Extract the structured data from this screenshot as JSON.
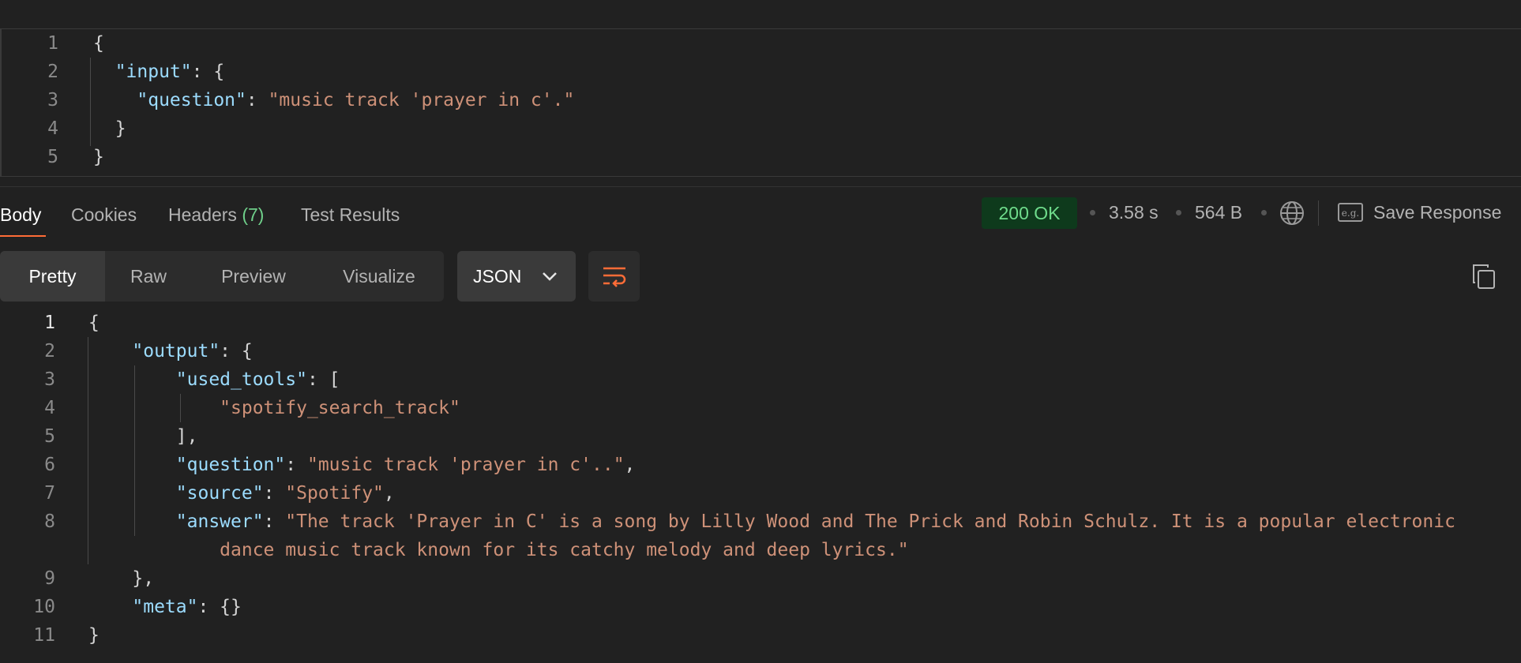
{
  "request": {
    "lines": [
      {
        "n": "1",
        "parts": [
          {
            "t": "{",
            "c": "p"
          }
        ]
      },
      {
        "n": "2",
        "parts": [
          {
            "t": "  ",
            "c": "p"
          },
          {
            "t": "\"input\"",
            "c": "k"
          },
          {
            "t": ": {",
            "c": "p"
          }
        ]
      },
      {
        "n": "3",
        "parts": [
          {
            "t": "    ",
            "c": "p"
          },
          {
            "t": "\"question\"",
            "c": "k"
          },
          {
            "t": ": ",
            "c": "p"
          },
          {
            "t": "\"music track 'prayer in c'.\"",
            "c": "s"
          }
        ]
      },
      {
        "n": "4",
        "parts": [
          {
            "t": "  }",
            "c": "p"
          }
        ]
      },
      {
        "n": "5",
        "parts": [
          {
            "t": "}",
            "c": "p"
          }
        ]
      }
    ]
  },
  "response_tabs": [
    {
      "label": "Body",
      "active": true
    },
    {
      "label": "Cookies"
    },
    {
      "label": "Headers",
      "count": "(7)"
    },
    {
      "label": "Test Results"
    }
  ],
  "status": {
    "code": "200 OK",
    "time": "3.58 s",
    "size": "564 B",
    "save_label": "Save Response"
  },
  "view_modes": [
    "Pretty",
    "Raw",
    "Preview",
    "Visualize"
  ],
  "format": "JSON",
  "response": {
    "lines": [
      {
        "n": "1",
        "parts": [
          {
            "t": "{",
            "c": "p"
          }
        ]
      },
      {
        "n": "2",
        "parts": [
          {
            "t": "    ",
            "c": "p"
          },
          {
            "t": "\"output\"",
            "c": "k"
          },
          {
            "t": ": {",
            "c": "p"
          }
        ]
      },
      {
        "n": "3",
        "parts": [
          {
            "t": "        ",
            "c": "p"
          },
          {
            "t": "\"used_tools\"",
            "c": "k"
          },
          {
            "t": ": [",
            "c": "p"
          }
        ]
      },
      {
        "n": "4",
        "parts": [
          {
            "t": "            ",
            "c": "p"
          },
          {
            "t": "\"spotify_search_track\"",
            "c": "s"
          }
        ]
      },
      {
        "n": "5",
        "parts": [
          {
            "t": "        ],",
            "c": "p"
          }
        ]
      },
      {
        "n": "6",
        "parts": [
          {
            "t": "        ",
            "c": "p"
          },
          {
            "t": "\"question\"",
            "c": "k"
          },
          {
            "t": ": ",
            "c": "p"
          },
          {
            "t": "\"music track 'prayer in c'..\"",
            "c": "s"
          },
          {
            "t": ",",
            "c": "p"
          }
        ]
      },
      {
        "n": "7",
        "parts": [
          {
            "t": "        ",
            "c": "p"
          },
          {
            "t": "\"source\"",
            "c": "k"
          },
          {
            "t": ": ",
            "c": "p"
          },
          {
            "t": "\"Spotify\"",
            "c": "s"
          },
          {
            "t": ",",
            "c": "p"
          }
        ]
      },
      {
        "n": "8",
        "parts": [
          {
            "t": "        ",
            "c": "p"
          },
          {
            "t": "\"answer\"",
            "c": "k"
          },
          {
            "t": ": ",
            "c": "p"
          },
          {
            "t": "\"The track 'Prayer in C' is a song by Lilly Wood and The Prick and Robin Schulz. It is a popular electronic",
            "c": "s"
          }
        ]
      },
      {
        "n": "",
        "parts": [
          {
            "t": "            ",
            "c": "p"
          },
          {
            "t": "dance music track known for its catchy melody and deep lyrics.\"",
            "c": "s"
          }
        ]
      },
      {
        "n": "9",
        "parts": [
          {
            "t": "    },",
            "c": "p"
          }
        ]
      },
      {
        "n": "10",
        "parts": [
          {
            "t": "    ",
            "c": "p"
          },
          {
            "t": "\"meta\"",
            "c": "k"
          },
          {
            "t": ": {}",
            "c": "p"
          }
        ]
      },
      {
        "n": "11",
        "parts": [
          {
            "t": "}",
            "c": "p"
          }
        ]
      }
    ]
  }
}
